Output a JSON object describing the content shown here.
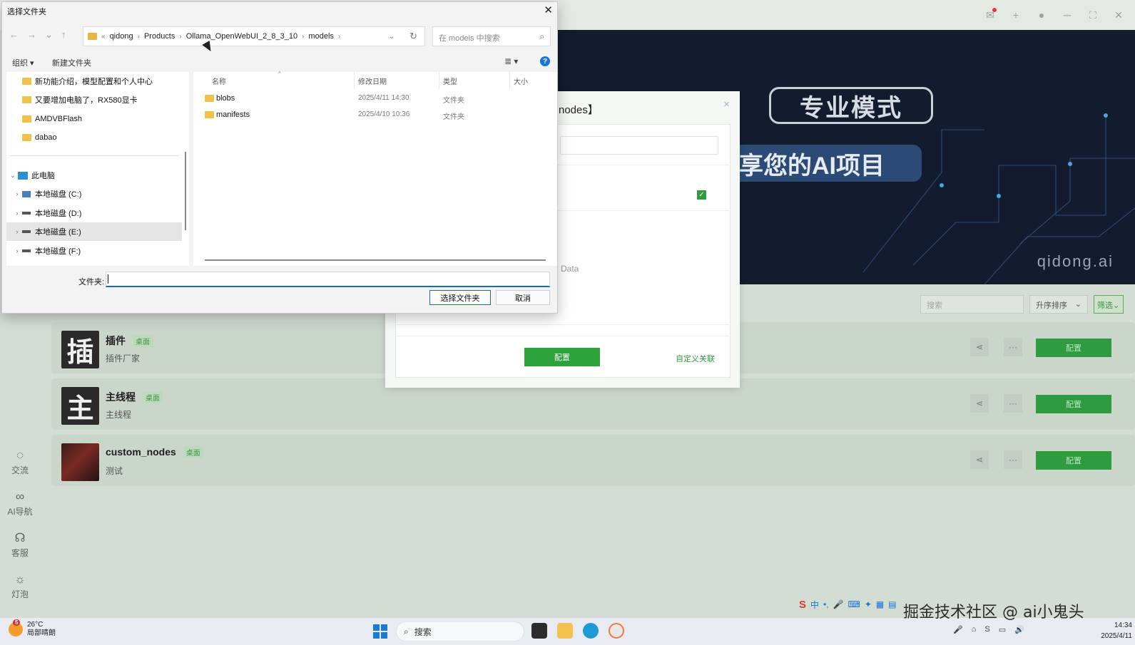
{
  "dialog": {
    "title": "选择文件夹",
    "close_glyph": "✕",
    "nav": {
      "back": "←",
      "forward": "→",
      "recent": "⌄",
      "up": "↑"
    },
    "breadcrumb": [
      "qidong",
      "Products",
      "Ollama_OpenWebUI_2_8_3_10",
      "models"
    ],
    "breadcrumb_prefix": "«",
    "search_placeholder": "在 models 中搜索",
    "toolbar": {
      "organize": "组织 ▾",
      "new_folder": "新建文件夹",
      "view": "≣ ▾",
      "help": "?"
    },
    "tree": {
      "quick_access": [
        "新功能介绍，模型配置和个人中心",
        "又要增加电脑了，RX580显卡",
        "AMDVBFlash",
        "dabao"
      ],
      "this_pc": "此电脑",
      "drives": [
        "本地磁盘 (C:)",
        "本地磁盘 (D:)",
        "本地磁盘 (E:)",
        "本地磁盘 (F:)"
      ],
      "selected_drive_index": 2
    },
    "columns": {
      "name": "名称",
      "modified": "修改日期",
      "type": "类型",
      "size": "大小"
    },
    "files": [
      {
        "name": "blobs",
        "modified": "2025/4/11 14:30",
        "type": "文件夹"
      },
      {
        "name": "manifests",
        "modified": "2025/4/10 10:36",
        "type": "文件夹"
      }
    ],
    "folder_label": "文件夹:",
    "folder_value": "",
    "select_button": "选择文件夹",
    "cancel_button": "取消"
  },
  "app": {
    "banner": {
      "badge": "专业模式",
      "slogan": "享您的AI项目",
      "brand": "qidong.ai"
    },
    "filter": {
      "search_placeholder": "搜索",
      "sort": "升序排序",
      "filter": "筛选"
    },
    "sidebar": [
      {
        "icon": "chat-icon",
        "glyph": "◌",
        "label": "交流"
      },
      {
        "icon": "link-icon",
        "glyph": "∞",
        "label": "AI导航"
      },
      {
        "icon": "headset-icon",
        "glyph": "☊",
        "label": "客服"
      },
      {
        "icon": "bulb-icon",
        "glyph": "☼",
        "label": "灯泡"
      }
    ],
    "cards": [
      {
        "avatar": "插",
        "title": "插件",
        "tag": "桌面",
        "subtitle": "插件厂家",
        "config": "配置"
      },
      {
        "avatar": "主",
        "title": "主线程",
        "tag": "桌面",
        "subtitle": "主线程",
        "config": "配置"
      },
      {
        "avatar": "",
        "title": "custom_nodes",
        "tag": "桌面",
        "subtitle": "测试",
        "config": "配置"
      }
    ],
    "modal": {
      "title_fragment": "nodes】",
      "close_glyph": "×",
      "data_label": "Data",
      "config_button": "配置",
      "custom_link": "自定义关联",
      "checkbox_checked": true
    },
    "topbar_icons": [
      "mail-icon",
      "plus-icon",
      "user-icon",
      "minimize-icon",
      "maximize-icon",
      "close-icon"
    ]
  },
  "taskbar": {
    "weather": {
      "temp": "26°C",
      "desc": "局部晴朗",
      "badge": "5"
    },
    "search_label": "搜索",
    "ime": [
      "S",
      "中",
      "•,",
      "🎤",
      "⌨",
      "✦",
      "▦",
      "▤"
    ],
    "watermark": "掘金技术社区 @ ai小鬼头",
    "clock": {
      "time": "14:34",
      "date": "2025/4/11"
    }
  }
}
